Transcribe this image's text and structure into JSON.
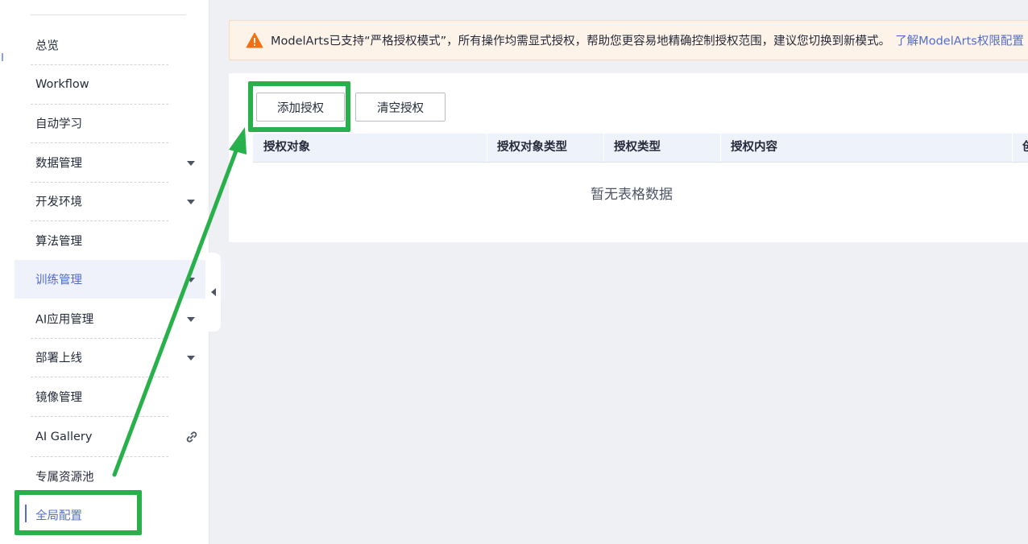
{
  "sidebar": {
    "items": [
      {
        "label": "总览",
        "caret": false
      },
      {
        "label": "Workflow",
        "caret": false
      },
      {
        "label": "自动学习",
        "caret": false
      },
      {
        "label": "数据管理",
        "caret": true
      },
      {
        "label": "开发环境",
        "caret": true
      },
      {
        "label": "算法管理",
        "caret": false
      },
      {
        "label": "训练管理",
        "caret": true,
        "state": "hover"
      },
      {
        "label": "AI应用管理",
        "caret": true
      },
      {
        "label": "部署上线",
        "caret": true
      },
      {
        "label": "镜像管理",
        "caret": false
      },
      {
        "label": "AI Gallery",
        "icon": "link-icon"
      },
      {
        "label": "专属资源池",
        "caret": false
      },
      {
        "label": "全局配置",
        "state": "current"
      }
    ]
  },
  "notice": {
    "icon": "warning-icon",
    "text": "ModelArts已支持“严格授权模式”，所有操作均需显式授权，帮助您更容易地精确控制授权范围，建议您切换到新模式。",
    "link": "了解ModelArts权限配置"
  },
  "toolbar": {
    "add_label": "添加授权",
    "clear_label": "清空授权"
  },
  "table": {
    "columns": [
      "授权对象",
      "授权对象类型",
      "授权类型",
      "授权内容",
      "创"
    ],
    "empty_text": "暂无表格数据"
  },
  "colors": {
    "accent": "#526ecc",
    "highlight": "#28b04a",
    "warning": "#f66f0e"
  }
}
